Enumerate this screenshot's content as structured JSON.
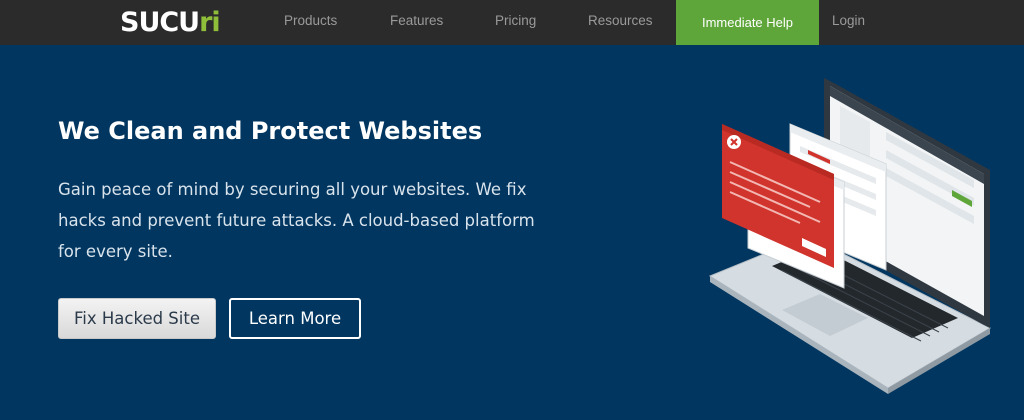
{
  "nav": {
    "logo_main": "SUCU",
    "logo_accent": "ri",
    "items": [
      {
        "label": "Products"
      },
      {
        "label": "Features"
      },
      {
        "label": "Pricing"
      },
      {
        "label": "Resources"
      }
    ],
    "cta_label": "Immediate Help",
    "login_label": "Login"
  },
  "hero": {
    "title": "We Clean and Protect Websites",
    "description": "Gain peace of mind by securing all your websites. We fix hacks and prevent future attacks. A cloud-based platform for every site.",
    "primary_button": "Fix Hacked Site",
    "secondary_button": "Learn More"
  },
  "colors": {
    "nav_bg": "#2b2b2b",
    "hero_bg": "#003660",
    "accent_green": "#5ea63a",
    "alert_red": "#d0342c"
  },
  "illustration": {
    "icon": "laptop-dashboard-illustration"
  }
}
